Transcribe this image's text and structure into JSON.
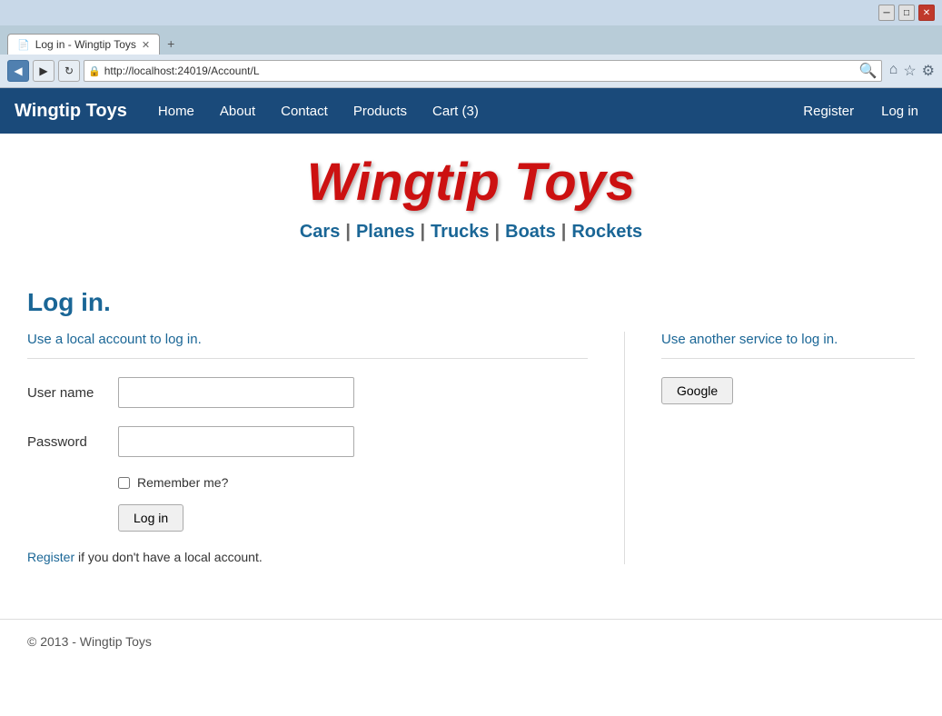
{
  "browser": {
    "url": "http://localhost:24019/Account/L",
    "tab_title": "Log in - Wingtip Toys",
    "back_icon": "◀",
    "forward_icon": "▶",
    "refresh_icon": "↻",
    "minimize_icon": "─",
    "maximize_icon": "□",
    "close_icon": "✕",
    "home_icon": "⌂",
    "star_icon": "☆",
    "settings_icon": "⚙",
    "search_icon": "🔍"
  },
  "site": {
    "brand": "Wingtip Toys",
    "nav": {
      "home": "Home",
      "about": "About",
      "contact": "Contact",
      "products": "Products",
      "cart": "Cart (3)",
      "register": "Register",
      "login": "Log in"
    },
    "logo_text": "Wingtip Toys",
    "categories": [
      "Cars",
      "Planes",
      "Trucks",
      "Boats",
      "Rockets"
    ],
    "page_title": "Log in.",
    "local_section_label": "Use a local account to log in.",
    "service_section_label": "Use another service to log in.",
    "form": {
      "username_label": "User name",
      "password_label": "Password",
      "remember_label": "Remember me?",
      "login_button": "Log in"
    },
    "google_button": "Google",
    "register_note_pre": "Register",
    "register_note_post": " if you don't have a local account.",
    "footer": "© 2013 - Wingtip Toys"
  }
}
